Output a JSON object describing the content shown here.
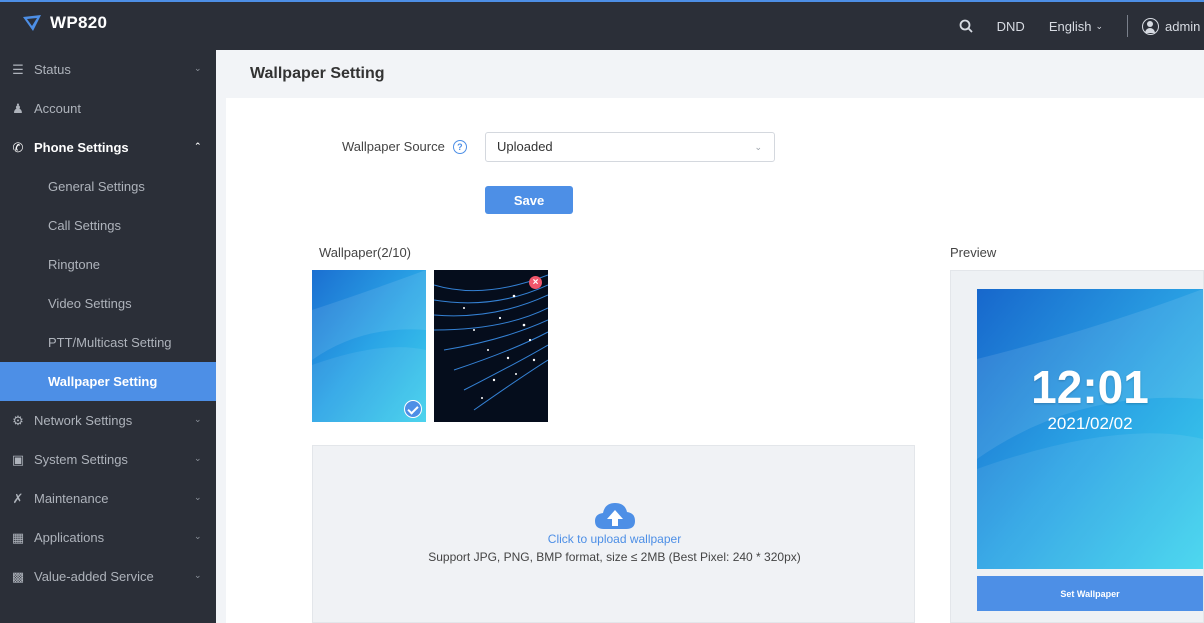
{
  "app": {
    "title": "WP820"
  },
  "topbar": {
    "dnd": "DND",
    "language": "English",
    "user": "admin"
  },
  "sidebar": {
    "items": [
      {
        "label": "Status",
        "icon": "list-icon"
      },
      {
        "label": "Account",
        "icon": "user-icon"
      },
      {
        "label": "Phone Settings",
        "icon": "phone-icon"
      },
      {
        "label": "Network Settings",
        "icon": "network-icon"
      },
      {
        "label": "System Settings",
        "icon": "system-icon"
      },
      {
        "label": "Maintenance",
        "icon": "tools-icon"
      },
      {
        "label": "Applications",
        "icon": "document-icon"
      },
      {
        "label": "Value-added Service",
        "icon": "grid-icon"
      }
    ],
    "phone_settings_sub": [
      "General Settings",
      "Call Settings",
      "Ringtone",
      "Video Settings",
      "PTT/Multicast Setting",
      "Wallpaper Setting"
    ]
  },
  "page": {
    "title": "Wallpaper Setting",
    "wallpaper_source_label": "Wallpaper Source",
    "wallpaper_source_value": "Uploaded",
    "save_label": "Save",
    "wallpaper_count_label": "Wallpaper(2/10)",
    "preview_label": "Preview",
    "upload_label": "Click to upload wallpaper",
    "upload_hint": "Support JPG, PNG, BMP format, size ≤ 2MB (Best Pixel: 240 * 320px)",
    "preview_time": "12:01",
    "preview_date": "2021/02/02",
    "set_wallpaper_label": "Set Wallpaper"
  },
  "colors": {
    "accent": "#4d8fe6",
    "sidebar_bg": "#2b2f38",
    "danger": "#f0566b"
  }
}
